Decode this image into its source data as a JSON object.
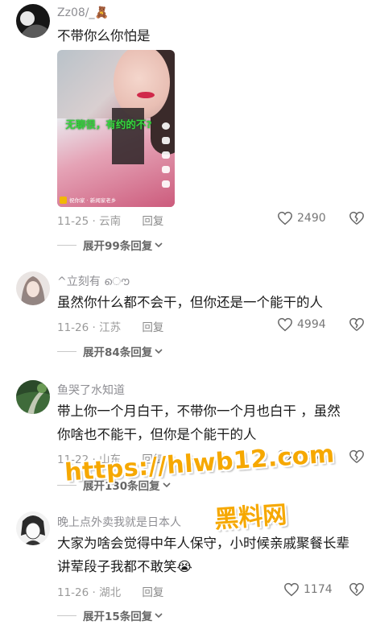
{
  "comments": [
    {
      "username": "Zz08/_🧸",
      "text": "不带你么你怕是",
      "video": {
        "caption": "无聊很，有约的不?",
        "footer": "祝你家 · 新闻家老乡"
      },
      "date": "11-25",
      "location": "云南",
      "reply_label": "回复",
      "likes": "2490",
      "expand": "展开99条回复"
    },
    {
      "username": "^立刻有 ൌ",
      "text": "虽然你什么都不会干，但你还是一个能干的人",
      "date": "11-26",
      "location": "江苏",
      "reply_label": "回复",
      "likes": "4994",
      "expand": "展开84条回复"
    },
    {
      "username": "鱼哭了水知道",
      "text_line1": "带上你一个月白干，不带你一个月也白干 ，虽然",
      "text_line2": "你啥也不能干，但你是个能干的人",
      "date": "11-22",
      "location": "山东",
      "reply_label": "回复",
      "likes": "5680",
      "expand": "展开130条回复"
    },
    {
      "username": "晚上点外卖我就是日本人",
      "text_line1": "大家为啥会觉得中年人保守，小时候亲戚聚餐长辈",
      "text_line2": "讲荤段子我都不敢笑😭",
      "date": "11-26",
      "location": "湖北",
      "reply_label": "回复",
      "likes": "1174",
      "expand": "展开15条回复"
    }
  ],
  "separator": " · ",
  "watermark": {
    "url": "https://hlwb12.com",
    "brand": "黑料网"
  },
  "colors": {
    "watermark": "#f6a800",
    "text": "#1a1a1a",
    "meta": "#9a9a9a",
    "caption": "#37d53e"
  }
}
